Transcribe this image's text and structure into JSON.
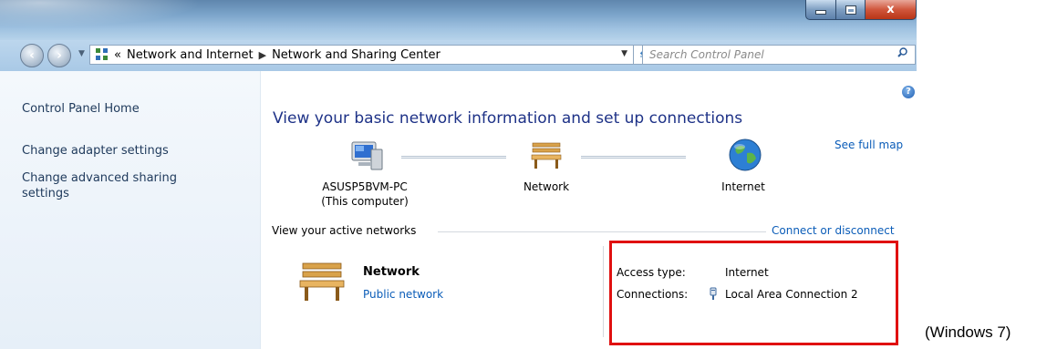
{
  "window": {
    "controls": {
      "minimize": "minimize",
      "maximize": "maximize",
      "close": "x"
    }
  },
  "navbar": {
    "breadcrumb_prefix": "«",
    "breadcrumb": [
      "Network and Internet",
      "Network and Sharing Center"
    ],
    "search_placeholder": "Search Control Panel"
  },
  "sidebar": {
    "items": [
      {
        "label": "Control Panel Home"
      },
      {
        "label": "Change adapter settings"
      },
      {
        "label": "Change advanced sharing settings"
      }
    ]
  },
  "main": {
    "title": "View your basic network information and set up connections",
    "see_full_map": "See full map",
    "map": {
      "computer_name": "ASUSP5BVM-PC",
      "computer_sub": "(This computer)",
      "network": "Network",
      "internet": "Internet"
    },
    "active_section_title": "View your active networks",
    "connect_link": "Connect or disconnect",
    "network": {
      "name": "Network",
      "type": "Public network",
      "access_type_label": "Access type:",
      "access_type_value": "Internet",
      "connections_label": "Connections:",
      "connections_value": "Local Area Connection 2"
    }
  },
  "caption": "(Windows 7)",
  "colors": {
    "link": "#0a5cb8",
    "title": "#1e3287",
    "highlight": "#e01010"
  }
}
